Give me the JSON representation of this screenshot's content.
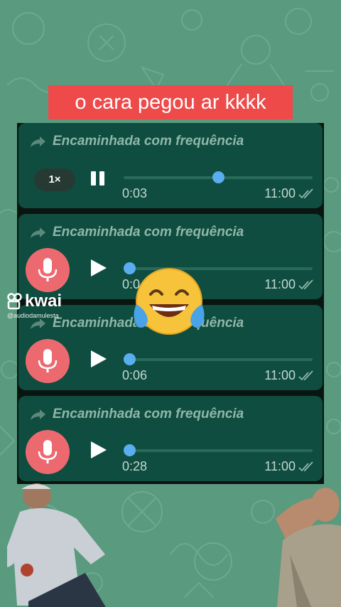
{
  "caption": "o cara pegou ar kkkk",
  "watermark": {
    "brand": "kwai",
    "handle": "@audiodamulesta"
  },
  "messages": [
    {
      "forward_label": "Encaminhada com frequência",
      "speed": "1×",
      "state": "playing",
      "duration": "0:03",
      "time": "11:00",
      "progress": 0.5
    },
    {
      "forward_label": "Encaminhada com frequência",
      "state": "paused",
      "duration": "0:0",
      "time": "11:00",
      "progress": 0.0
    },
    {
      "forward_label": "Encaminhada com frequência",
      "state": "paused",
      "duration": "0:06",
      "time": "11:00",
      "progress": 0.0
    },
    {
      "forward_label": "Encaminhada com frequência",
      "state": "paused",
      "duration": "0:28",
      "time": "11:00",
      "progress": 0.0
    }
  ],
  "overlay_emoji": "face-with-tears-of-joy",
  "colors": {
    "background": "#5a9a7e",
    "bubble": "#0e4d40",
    "caption": "#ef4a4a",
    "mic": "#ec6a6f",
    "knob": "#5aaef0"
  }
}
